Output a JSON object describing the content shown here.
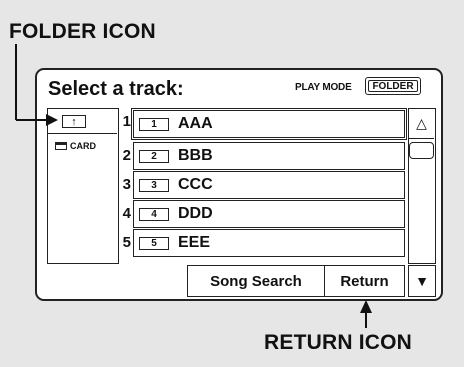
{
  "callouts": {
    "folder_icon": "FOLDER ICON",
    "return_icon": "RETURN ICON"
  },
  "screen": {
    "title": "Select a track:",
    "play_mode_label": "PLAY MODE",
    "folder_button": "FOLDER",
    "sidebar": {
      "up_folder_glyph": "↑",
      "card_label": "CARD"
    },
    "tracks": [
      {
        "num": "1",
        "icon": "1",
        "label": "AAA"
      },
      {
        "num": "2",
        "icon": "2",
        "label": "BBB"
      },
      {
        "num": "3",
        "icon": "3",
        "label": "CCC"
      },
      {
        "num": "4",
        "icon": "4",
        "label": "DDD"
      },
      {
        "num": "5",
        "icon": "5",
        "label": "EEE"
      }
    ],
    "scroll_up_glyph": "△",
    "scroll_down_glyph": "▼",
    "song_search_button": "Song Search",
    "return_button": "Return"
  }
}
